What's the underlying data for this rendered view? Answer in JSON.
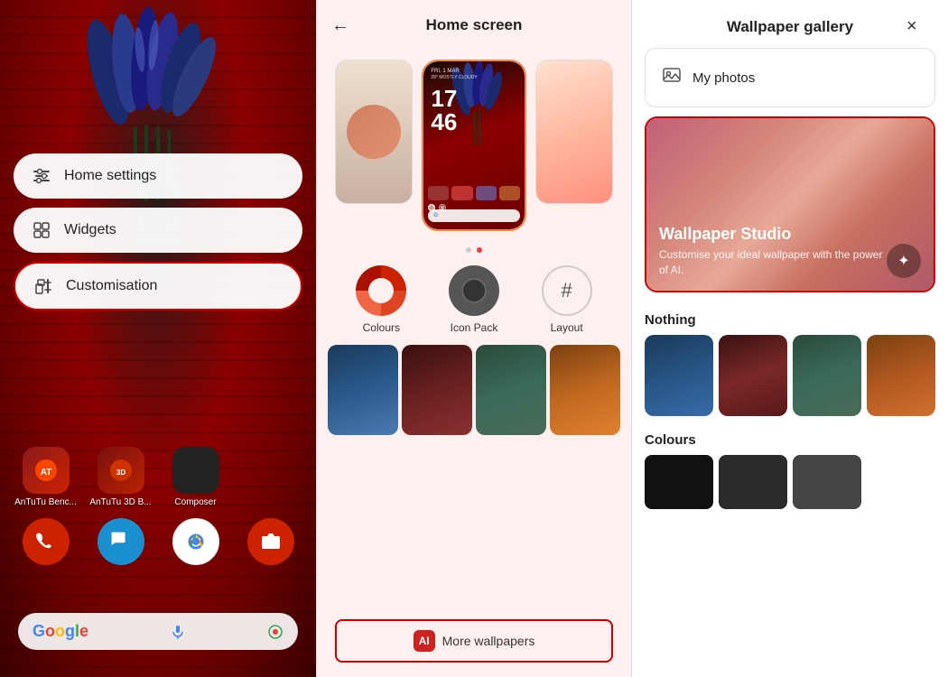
{
  "panel1": {
    "menu": {
      "items": [
        {
          "id": "home-settings",
          "label": "Home settings",
          "icon": "⚙"
        },
        {
          "id": "widgets",
          "label": "Widgets",
          "icon": "▦"
        },
        {
          "id": "customisation",
          "label": "Customisation",
          "icon": "📌",
          "highlighted": true
        }
      ]
    },
    "apps": [
      {
        "id": "antutu",
        "label": "AnTuTu Benc...",
        "color": "#8b1a1a",
        "emoji": "🔥"
      },
      {
        "id": "antutu3d",
        "label": "AnTuTu 3D B...",
        "color": "#7a1010",
        "emoji": "🔥"
      },
      {
        "id": "composer",
        "label": "Composer",
        "color": "#222",
        "emoji": "⊞"
      },
      {
        "id": "phone",
        "label": "",
        "color": "#cc2200",
        "emoji": "📞"
      },
      {
        "id": "chat",
        "label": "",
        "color": "#1a90d0",
        "emoji": "💬"
      },
      {
        "id": "chrome",
        "label": "",
        "color": "#fff",
        "emoji": "🌐"
      },
      {
        "id": "camera",
        "label": "",
        "color": "#cc2200",
        "emoji": "📷"
      }
    ],
    "search_placeholder": "Google search"
  },
  "panel2": {
    "title": "Home screen",
    "back_label": "←",
    "phone_preview": {
      "date": "FRI, 1 MAR",
      "weather": "28° MOSTLY CLOUDY",
      "time": "17:46"
    },
    "options": [
      {
        "id": "colours",
        "label": "Colours"
      },
      {
        "id": "icon-pack",
        "label": "Icon Pack"
      },
      {
        "id": "layout",
        "label": "Layout"
      }
    ],
    "dots": [
      "inactive",
      "active"
    ],
    "more_wallpapers_label": "More wallpapers",
    "more_ai_label": "AI"
  },
  "panel3": {
    "title": "Wallpaper gallery",
    "close_label": "×",
    "my_photos_label": "My photos",
    "wallpaper_studio": {
      "title": "Wallpaper Studio",
      "subtitle": "Customise your ideal wallpaper with the power of AI.",
      "btn_icon": "✦"
    },
    "sections": [
      {
        "id": "nothing",
        "title": "Nothing",
        "thumbs": [
          "grad-wave-blue",
          "grad-wave-red",
          "grad-wave-green",
          "grad-orange-partial"
        ]
      },
      {
        "id": "colours",
        "title": "Colours",
        "thumbs": [
          "col-black",
          "col-dark",
          "col-mid"
        ]
      }
    ]
  }
}
